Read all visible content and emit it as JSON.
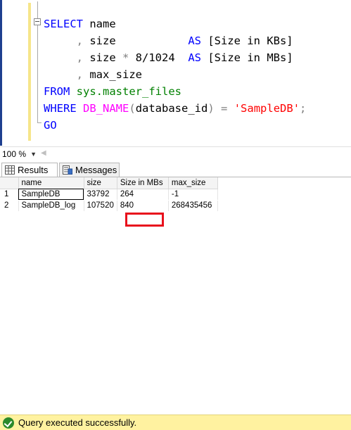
{
  "editor": {
    "lines": [
      {
        "parts": [
          [
            "kw",
            "SELECT"
          ],
          [
            "id",
            " name"
          ]
        ]
      },
      {
        "parts": [
          [
            "op",
            "     ,"
          ],
          [
            "id",
            " size           "
          ],
          [
            "kw",
            "AS"
          ],
          [
            "id",
            " [Size in KBs]"
          ]
        ]
      },
      {
        "parts": [
          [
            "op",
            "     ,"
          ],
          [
            "id",
            " size "
          ],
          [
            "op",
            "*"
          ],
          [
            "id",
            " 8/1024  "
          ],
          [
            "kw",
            "AS"
          ],
          [
            "id",
            " [Size in MBs]"
          ]
        ]
      },
      {
        "parts": [
          [
            "op",
            "     ,"
          ],
          [
            "id",
            " max_size"
          ]
        ]
      },
      {
        "parts": [
          [
            "kw",
            "FROM"
          ],
          [
            "id",
            " "
          ],
          [
            "sys",
            "sys.master_files"
          ]
        ]
      },
      {
        "parts": [
          [
            "kw",
            "WHERE"
          ],
          [
            "id",
            " "
          ],
          [
            "fn",
            "DB_NAME"
          ],
          [
            "op",
            "("
          ],
          [
            "id",
            "database_id"
          ],
          [
            "op",
            ")"
          ],
          [
            "id",
            " "
          ],
          [
            "op",
            "="
          ],
          [
            "id",
            " "
          ],
          [
            "str",
            "'SampleDB'"
          ],
          [
            "op",
            ";"
          ]
        ]
      },
      {
        "parts": [
          [
            "kw",
            "GO"
          ]
        ]
      }
    ]
  },
  "zoom": {
    "value": "100 %"
  },
  "tabs": {
    "results_label": "Results",
    "messages_label": "Messages"
  },
  "grid": {
    "columns": [
      "",
      "name",
      "size",
      "Size in MBs",
      "max_size"
    ],
    "rows": [
      [
        "1",
        "SampleDB",
        "33792",
        "264",
        "-1"
      ],
      [
        "2",
        "SampleDB_log",
        "107520",
        "840",
        "268435456"
      ]
    ]
  },
  "status": {
    "text": "Query executed successfully."
  },
  "colors": {
    "keyword": "#0000ff",
    "system": "#008000",
    "function": "#ff00ff",
    "string": "#ff0000",
    "status_bg": "#fff2a0",
    "highlight": "#e8101c"
  }
}
